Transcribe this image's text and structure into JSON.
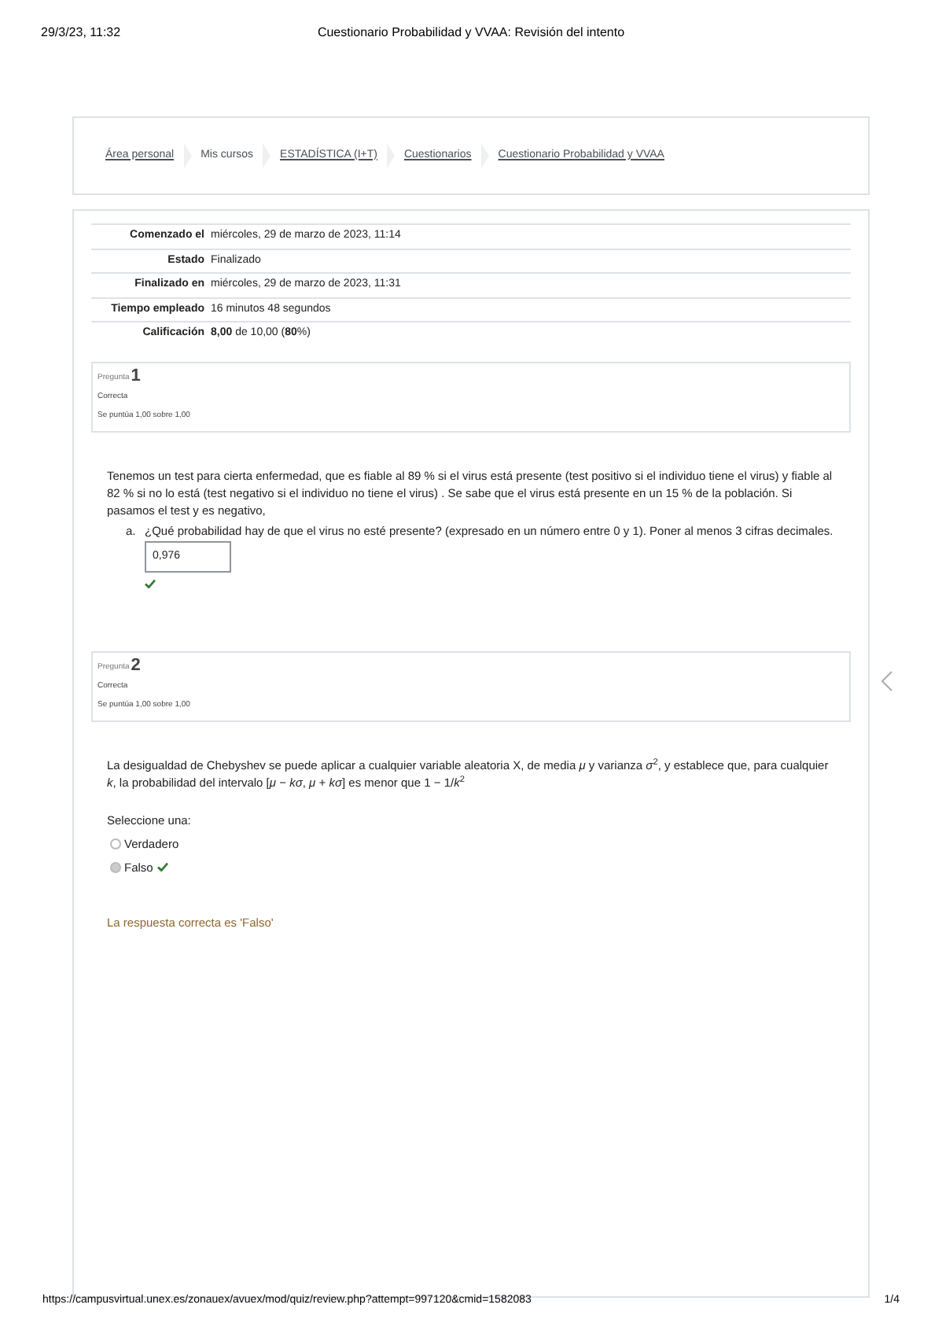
{
  "print_header": {
    "date": "29/3/23, 11:32",
    "title": "Cuestionario Probabilidad y VVAA: Revisión del intento"
  },
  "breadcrumb": [
    {
      "label": "Área personal",
      "link": true
    },
    {
      "label": "Mis cursos",
      "link": false
    },
    {
      "label": "ESTADÍSTICA (I+T)",
      "link": true
    },
    {
      "label": "Cuestionarios",
      "link": true
    },
    {
      "label": "Cuestionario Probabilidad y VVAA",
      "link": true
    }
  ],
  "summary": [
    {
      "label": "Comenzado el",
      "value": "miércoles, 29 de marzo de 2023, 11:14"
    },
    {
      "label": "Estado",
      "value": "Finalizado"
    },
    {
      "label": "Finalizado en",
      "value": "miércoles, 29 de marzo de 2023, 11:31"
    },
    {
      "label": "Tiempo empleado",
      "value": "16 minutos 48 segundos"
    },
    {
      "label": "Calificación",
      "value": "**8,00** de 10,00 (**80**%)"
    }
  ],
  "questions": [
    {
      "prefix": "Pregunta",
      "number": "1",
      "state": "Correcta",
      "mark": "Se puntúa 1,00 sobre 1,00",
      "kind": "numeric",
      "text": "Tenemos un test para cierta enfermedad, que es fiable al 89 % si el virus está presente (test positivo si el individuo tiene el virus) y fiable al 82 % si no lo está (test negativo si el individuo no tiene el virus) . Se sabe que el virus está presente en un 15 % de la población. Si pasamos el test y es negativo,",
      "parts": [
        {
          "marker": "a.",
          "prompt": "¿Qué probabilidad hay de que el virus no esté presente? (expresado en un número entre 0 y 1). Poner al menos 3 cifras decimales.",
          "answer": "0,976",
          "correct": true
        }
      ]
    },
    {
      "prefix": "Pregunta",
      "number": "2",
      "state": "Correcta",
      "mark": "Se puntúa 1,00 sobre 1,00",
      "kind": "truefalse",
      "text": "La desigualdad de Chebyshev se puede aplicar a cualquier variable aleatoria X, de media *μ* y varianza *σ*$^{2}$, y establece que, para cualquier *k*, la probabilidad del intervalo [*μ* − *kσ*, *μ* + *kσ*] es menor que 1 − 1/*k*$^{2}$",
      "instruction": "Seleccione una:",
      "options": [
        {
          "label": "Verdadero",
          "selected": false,
          "correct": false
        },
        {
          "label": "Falso",
          "selected": true,
          "correct": true
        }
      ],
      "feedback": "La respuesta correcta es 'Falso'"
    }
  ],
  "print_footer": {
    "url": "https://campusvirtual.unex.es/zonauex/avuex/mod/quiz/review.php?attempt=997120&cmid=1582083",
    "page": "1/4"
  }
}
